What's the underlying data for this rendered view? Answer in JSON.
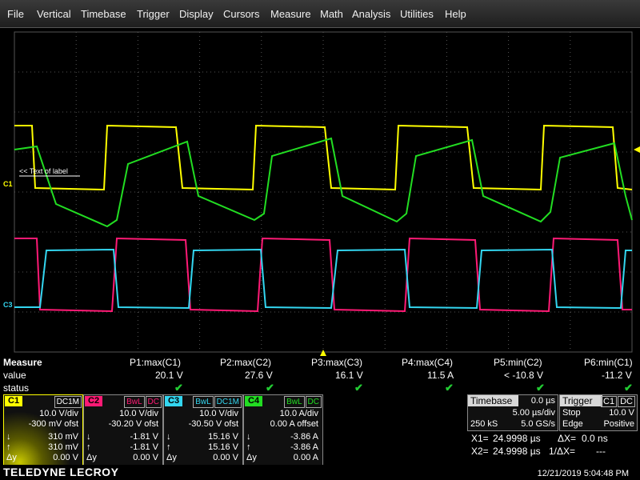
{
  "menu": [
    "File",
    "Vertical",
    "Timebase",
    "Trigger",
    "Display",
    "Cursors",
    "Measure",
    "Math",
    "Analysis",
    "Utilities",
    "Help"
  ],
  "colors": {
    "c1": "#ffff00",
    "c2": "#ff1a75",
    "c3": "#33d6f0",
    "c4": "#22dd22",
    "grid": "#555555",
    "check": "#22cc33"
  },
  "waveform": {
    "label_text": "<< Text of label",
    "c1_marker": "C1",
    "c3_marker": "C3"
  },
  "measure": {
    "title": "Measure",
    "row_value": "value",
    "row_status": "status",
    "params": [
      {
        "name": "P1:max(C1)",
        "value": "20.1 V"
      },
      {
        "name": "P2:max(C2)",
        "value": "27.6 V"
      },
      {
        "name": "P3:max(C3)",
        "value": "16.1 V"
      },
      {
        "name": "P4:max(C4)",
        "value": "11.5 A"
      },
      {
        "name": "P5:min(C2)",
        "value": "< -10.8 V"
      },
      {
        "name": "P6:min(C1)",
        "value": "-11.2 V"
      }
    ],
    "check_glyph": "✔"
  },
  "channels": [
    {
      "tag": "C1",
      "flags": [
        "DC1M"
      ],
      "vdiv": "10.0 V/div",
      "offset": "-300 mV ofst",
      "down": "310 mV",
      "up": "310 mV",
      "dy": "0.00 V",
      "color": "#ffff00"
    },
    {
      "tag": "C2",
      "flags": [
        "BwL",
        "DC"
      ],
      "vdiv": "10.0 V/div",
      "offset": "-30.20 V ofst",
      "down": "-1.81 V",
      "up": "-1.81 V",
      "dy": "0.00 V",
      "color": "#ff1a75"
    },
    {
      "tag": "C3",
      "flags": [
        "BwL",
        "DC1M"
      ],
      "vdiv": "10.0 V/div",
      "offset": "-30.50 V ofst",
      "down": "15.16 V",
      "up": "15.16 V",
      "dy": "0.00 V",
      "color": "#33d6f0"
    },
    {
      "tag": "C4",
      "flags": [
        "BwL",
        "DC"
      ],
      "vdiv": "10.0 A/div",
      "offset": "0.00 A offset",
      "down": "-3.86 A",
      "up": "-3.86 A",
      "dy": "0.00 A",
      "color": "#22dd22"
    }
  ],
  "channel_labels": {
    "down": "↓",
    "up": "↑",
    "dy": "Δy"
  },
  "timebase": {
    "title": "Timebase",
    "delay": "0.0 µs",
    "per_div": "5.00 µs/div",
    "samples": "250 kS",
    "rate": "5.0 GS/s"
  },
  "trigger": {
    "title": "Trigger",
    "tags": [
      "C1",
      "DC"
    ],
    "mode": "Stop",
    "level": "10.0 V",
    "type": "Edge",
    "slope": "Positive"
  },
  "cursors": {
    "x1_label": "X1=",
    "x1": "24.9998 µs",
    "x2_label": "X2=",
    "x2": "24.9998 µs",
    "dx_label": "ΔX=",
    "dx": "0.0 ns",
    "inv_label": "1/ΔX=",
    "inv": "---"
  },
  "footer": {
    "brand": "TELEDYNE LECROY",
    "datetime": "12/21/2019 5:04:48 PM"
  }
}
